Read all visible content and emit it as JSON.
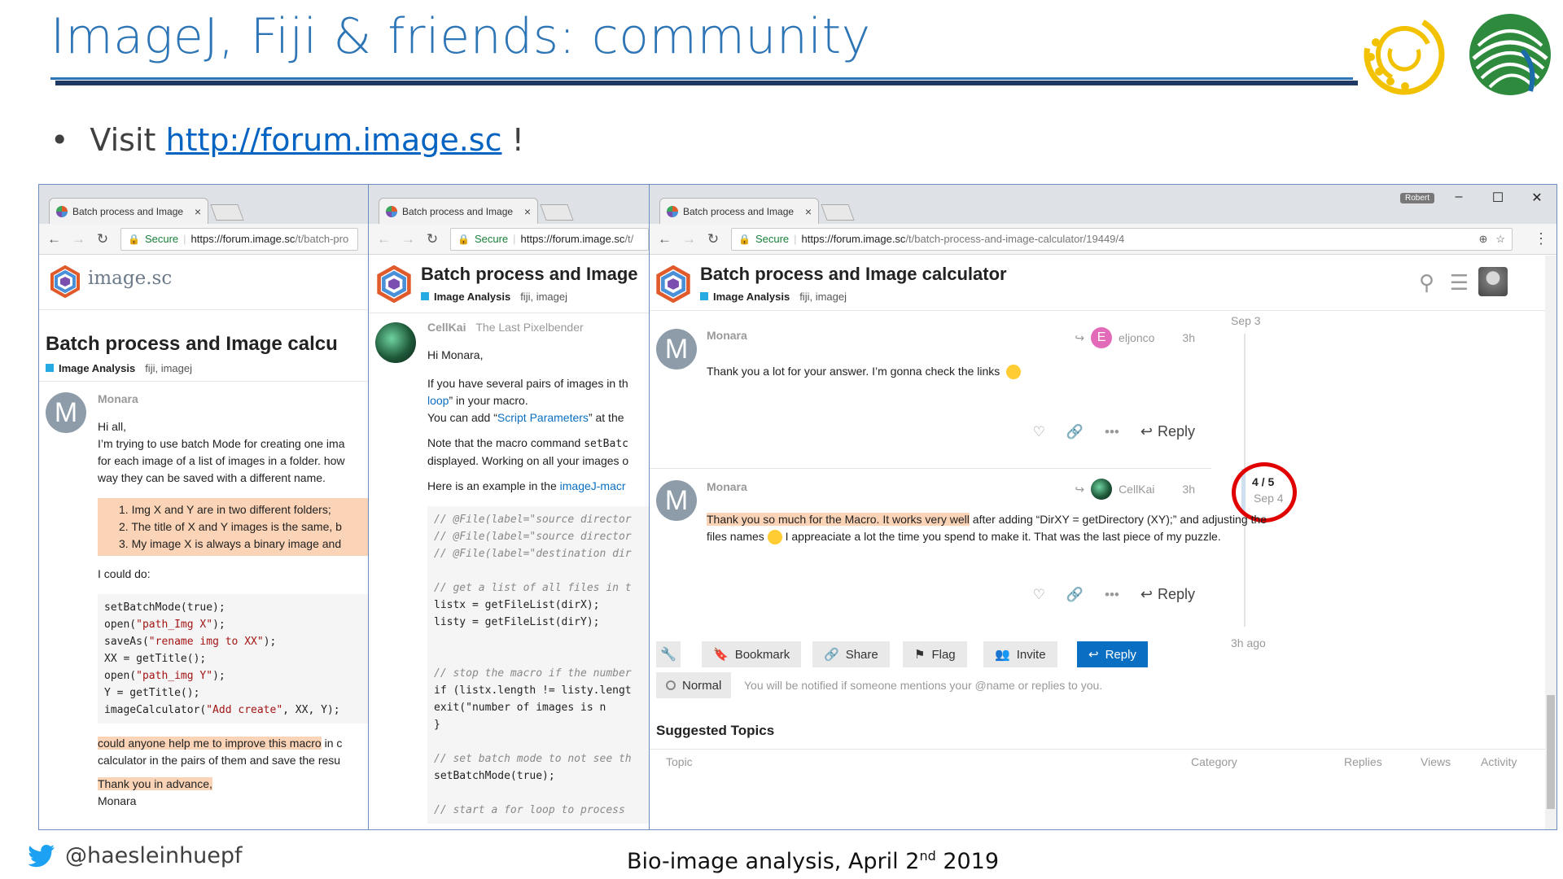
{
  "slide": {
    "title": "ImageJ, Fiji & friends: community",
    "bullet_prefix": "Visit",
    "bullet_link": "http://forum.image.sc",
    "bullet_suffix": "!",
    "twitter_handle": "@haesleinhuepf",
    "footer_date_pre": "Bio-image analysis, April 2",
    "footer_date_sup": "nd",
    "footer_date_post": "2019"
  },
  "browser": {
    "tab_title": "Batch process and Image",
    "tab_close": "×",
    "secure_label": "Secure",
    "url_host": "https://forum.image.sc",
    "url_path_short": "/t/batch-pro",
    "url_path_short2": "/t/",
    "url_path_full": "/t/batch-process-and-image-calculator/19449/4",
    "user_chip": "Robert",
    "window_controls": [
      "–",
      "☐",
      "✕"
    ]
  },
  "win1": {
    "site_name": "image.sc",
    "topic_title": "Batch process and Image calcu",
    "category": "Image Analysis",
    "tags": "fiji, imagej",
    "author": "Monara",
    "avatar_letter": "M",
    "greeting": "Hi all,",
    "intro_1": "I’m trying to use batch Mode for creating one ima",
    "intro_2": "for each image of a list of images in a folder. how",
    "intro_3": "way they can be saved with a different name.",
    "list": [
      "1.  Img X and Y are in two different folders;",
      "2.  The title of X and Y images is the same, b",
      "3.  My image X is always a binary image and"
    ],
    "could_do": "I could do:",
    "code": [
      [
        "setBatchMode(true);",
        ""
      ],
      [
        "open(",
        "\"path_Img X\"",
        ");"
      ],
      [
        "saveAs(",
        "\"rename img to XX\"",
        ");"
      ],
      [
        "XX = getTitle();",
        ""
      ],
      [
        "open(",
        "\"path_img Y\"",
        ");"
      ],
      [
        "Y = getTitle();",
        ""
      ],
      [
        "imageCalculator(",
        "\"Add create\"",
        ", XX, Y);"
      ]
    ],
    "help_hl": "could anyone help me to improve this macro",
    "help_rest": " in c",
    "help_2": "calculator in the pairs of them and save the resu",
    "thanks": "Thank you in advance,",
    "signoff": "Monara"
  },
  "win2": {
    "topic_title": "Batch process and Image",
    "category": "Image Analysis",
    "tags": "fiji, imagej",
    "author": "CellKai",
    "author_title": "The Last Pixelbender",
    "greeting": "Hi Monara,",
    "p1_1": "If you have several pairs of images in th",
    "p1_link": "loop",
    "p1_2": "” in your macro.",
    "p1_3": "You can add “",
    "p1_link2": "Script Parameters",
    "p1_4": "” at the",
    "p2_1": "Note that the macro command ",
    "p2_code": "setBatc",
    "p2_2": "displayed. Working on all your images o",
    "p3_1": "Here is an example in the ",
    "p3_link": "imageJ-macr",
    "code": [
      "// @File(label=\"source director",
      "// @File(label=\"source director",
      "// @File(label=\"destination dir",
      "",
      "// get a list of all files in t",
      "listx = getFileList(dirX);",
      "listy = getFileList(dirY);",
      "",
      "",
      "// stop the macro if the number",
      "if (listx.length != listy.lengt",
      "    exit(\"number of images is n",
      "}",
      "",
      "// set batch mode to not see th",
      "setBatchMode(true);",
      "",
      "// start a for loop to process"
    ]
  },
  "win3": {
    "topic_title": "Batch process and Image calculator",
    "category": "Image Analysis",
    "tags": "fiji, imagej",
    "timeline_top": "Sep 3",
    "timeline_progress": "4 / 5",
    "timeline_date": "Sep 4",
    "timeline_bottom": "3h ago",
    "post1": {
      "author": "Monara",
      "avatar_letter": "M",
      "reply_to_letter": "E",
      "reply_to": "eljonco",
      "age": "3h",
      "text": "Thank you a lot for your answer. I’m gonna check the links",
      "reply_label": "Reply"
    },
    "post2": {
      "author": "Monara",
      "avatar_letter": "M",
      "reply_to": "CellKai",
      "age": "3h",
      "text_hl": "Thank you so much for the Macro. It works very well",
      "text_rest": " after adding “DirXY = getDirectory (XY);” and adjusting the",
      "text_2a": "files names",
      "text_2b": " I appreaciate a lot the time you spend to make it. That was the last piece of my puzzle.",
      "reply_label": "Reply"
    },
    "footer_buttons": {
      "bookmark": "Bookmark",
      "share": "Share",
      "flag": "Flag",
      "invite": "Invite",
      "reply": "Reply"
    },
    "notify_level": "Normal",
    "notify_text": "You will be notified if someone mentions your @name or replies to you.",
    "suggested_title": "Suggested Topics",
    "columns": [
      "Topic",
      "Category",
      "Replies",
      "Views",
      "Activity"
    ]
  },
  "colors": {
    "title_blue": "#2e75b6",
    "link_blue": "#0563c1",
    "forum_blue": "#0a6fc2",
    "highlight": "#fbd3b6",
    "circle_red": "#e00000"
  }
}
